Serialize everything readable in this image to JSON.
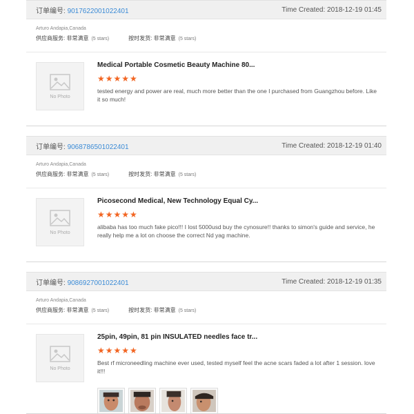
{
  "orders": [
    {
      "order_label": "订单编号:",
      "order_number": "9017622001022401",
      "time_created": "Time Created: 2018-12-19 01:45",
      "buyer": "Arturo Andapia,Canada",
      "supplier_label": "供应商服务:",
      "supplier_value": "非常满意",
      "supplier_stars": "(5 stars)",
      "shipping_label": "按时发货:",
      "shipping_value": "非常满意",
      "shipping_stars": "(5 stars)",
      "product_title": "Medical Portable Cosmetic Beauty Machine 80...",
      "stars": "★★★★★",
      "rating": 5,
      "review": "tested energy and power are real, much more better than the one I purchased from Guangzhou before.  Like  it so much!",
      "no_photo": "No Photo"
    },
    {
      "order_label": "订单编号:",
      "order_number": "9068786501022401",
      "time_created": "Time Created: 2018-12-19 01:40",
      "buyer": "Arturo Andapia,Canada",
      "supplier_label": "供应商服务:",
      "supplier_value": "非常满意",
      "supplier_stars": "(5 stars)",
      "shipping_label": "按时发货:",
      "shipping_value": "非常满意",
      "shipping_stars": "(5 stars)",
      "product_title": "Picosecond Medical, New Technology Equal Cy...",
      "stars": "★★★★★",
      "rating": 5,
      "review": "alibaba has too much fake pico!!! I lost 5000usd buy the cynosure!! thanks to simon's guide and service, he  really help me a lot on choose the correct Nd yag machine.",
      "no_photo": "No Photo"
    },
    {
      "order_label": "订单编号:",
      "order_number": "9086927001022401",
      "time_created": "Time Created: 2018-12-19 01:35",
      "buyer": "Arturo Andapia,Canada",
      "supplier_label": "供应商服务:",
      "supplier_value": "非常满意",
      "supplier_stars": "(5 stars)",
      "shipping_label": "按时发货:",
      "shipping_value": "非常满意",
      "shipping_stars": "(5 stars)",
      "product_title": "25pin, 49pin, 81 pin INSULATED needles face tr...",
      "stars": "★★★★★",
      "rating": 5,
      "review": "Best rf microneedling machine ever used, tested myself feel the acne scars faded a lot after 1 session. love  it!!!",
      "no_photo": "No Photo",
      "photo_count": 4
    }
  ]
}
